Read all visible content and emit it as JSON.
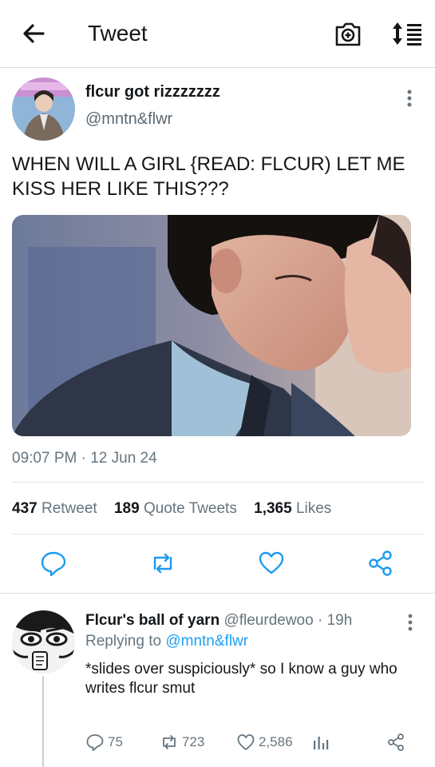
{
  "header": {
    "title": "Tweet",
    "back_icon": "arrow-left-icon",
    "camera_icon": "camera-plus-icon",
    "sort_icon": "sort-list-icon"
  },
  "tweet": {
    "author_name": "flcur got rizzzzzzz",
    "author_handle": "@mntn&flwr",
    "text": "WHEN WILL A GIRL {READ: FLCUR) LET ME KISS HER LIKE THIS???",
    "timestamp": "09:07 PM · 12 Jun 24",
    "stats": {
      "retweets_count": "437",
      "retweets_label": "Retweet",
      "quotes_count": "189",
      "quotes_label": "Quote Tweets",
      "likes_count": "1,365",
      "likes_label": "Likes"
    }
  },
  "reply": {
    "author_name": "Flcur's ball of yarn",
    "author_handle": "@fleurdewoo",
    "time": "· 19h",
    "replying_prefix": "Replying to",
    "replying_handle": "@mntn&flwr",
    "text": "*slides over suspiciously* so I know a guy who writes flcur smut",
    "reply_count": "75",
    "retweet_count": "723",
    "like_count": "2,586"
  },
  "colors": {
    "text": "#14171a",
    "secondary": "#66757f",
    "link": "#1da1f2",
    "divider": "#e1e5e8"
  }
}
